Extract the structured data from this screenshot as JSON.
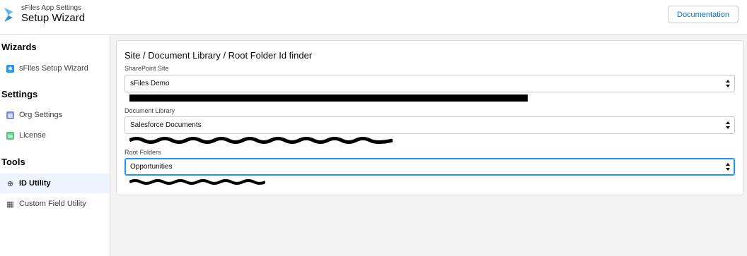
{
  "header": {
    "app_subtitle": "sFiles App Settings",
    "app_title": "Setup Wizard",
    "documentation_label": "Documentation"
  },
  "sidebar": {
    "sections": [
      {
        "label": "Wizards",
        "items": [
          {
            "label": "sFiles Setup Wizard",
            "icon": "asterisk-icon"
          }
        ]
      },
      {
        "label": "Settings",
        "items": [
          {
            "label": "Org Settings",
            "icon": "grid-icon"
          },
          {
            "label": "License",
            "icon": "document-icon"
          }
        ]
      },
      {
        "label": "Tools",
        "items": [
          {
            "label": "ID Utility",
            "icon": "globe-icon",
            "active": true
          },
          {
            "label": "Custom Field Utility",
            "icon": "table-icon"
          }
        ]
      }
    ]
  },
  "main": {
    "title": "Site / Document Library / Root Folder Id finder",
    "fields": [
      {
        "label": "SharePoint Site",
        "value": "sFiles Demo"
      },
      {
        "label": "Document Library",
        "value": "Salesforce Documents"
      },
      {
        "label": "Root Folders",
        "value": "Opportunities"
      }
    ]
  },
  "colors": {
    "accent": "#0070d2",
    "wizard_icon": "#1b96ff",
    "org_settings_icon": "#7f8de1",
    "license_icon": "#4bca81",
    "focus_border": "#1b96ff",
    "active_bg": "#eef4ff"
  }
}
